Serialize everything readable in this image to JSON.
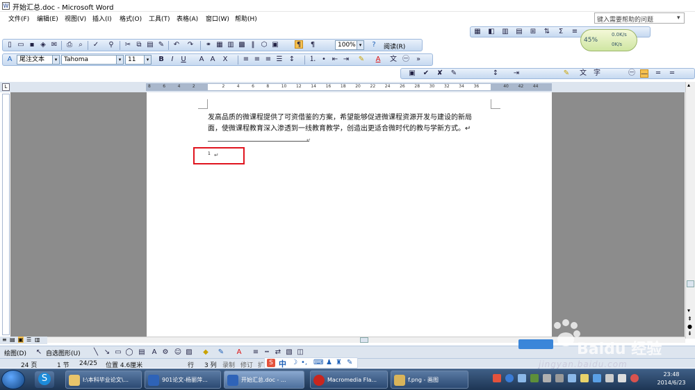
{
  "window": {
    "title": "开始汇总.doc - Microsoft Word",
    "app_icon": "word-doc-icon"
  },
  "menu": {
    "items": [
      "文件(F)",
      "编辑(E)",
      "视图(V)",
      "插入(I)",
      "格式(O)",
      "工具(T)",
      "表格(A)",
      "窗口(W)",
      "帮助(H)"
    ]
  },
  "help": {
    "placeholder": "键入需要帮助的问题"
  },
  "toolbar": {
    "zoom": "100%",
    "read_label": "阅读(R)"
  },
  "format": {
    "style": "尾注文本",
    "font": "Tahoma",
    "size": "11"
  },
  "gauge": {
    "percent": "45%",
    "speed1": "0.0K/s",
    "speed2": "0K/s"
  },
  "ruler": {
    "ticks": [
      "8",
      "6",
      "4",
      "2",
      "",
      "2",
      "4",
      "6",
      "8",
      "10",
      "12",
      "14",
      "16",
      "18",
      "20",
      "22",
      "24",
      "26",
      "28",
      "30",
      "32",
      "34",
      "36",
      "",
      "40",
      "42",
      "44"
    ]
  },
  "document": {
    "line1": "发高品质的微课程提供了可资借鉴的方案，希望能够促进微课程资源开发与建设的新局",
    "line2": "面，使微课程教育深入渗透到一线教育教学，创造出更适合微时代的教与学新方式。↵",
    "footnote_number": "1",
    "footnote_mark": "↵"
  },
  "drawbar": {
    "draw_label": "绘图(D)",
    "autoshape_label": "自选图形(U)"
  },
  "status": {
    "page": "24 页",
    "section": "1 节",
    "page_of": "24/25",
    "position": "位置 4.6厘米",
    "line": "行",
    "col": "3 列",
    "rec": "录制",
    "trk": "修订",
    "ext": "扩"
  },
  "ime": {
    "label": "中"
  },
  "watermark": {
    "brand": "Baidu 经验",
    "url": "jingyan.baidu.com"
  },
  "taskbar": {
    "items": [
      {
        "label": "I:\\本科毕业论文\\..."
      },
      {
        "label": "901论文-杨丽萍..."
      },
      {
        "label": "开始汇总.doc - ..."
      },
      {
        "label": "Macromedia Fla..."
      },
      {
        "label": "f.png - 画图"
      }
    ],
    "time": "23:48",
    "date": "2014/6/23"
  }
}
